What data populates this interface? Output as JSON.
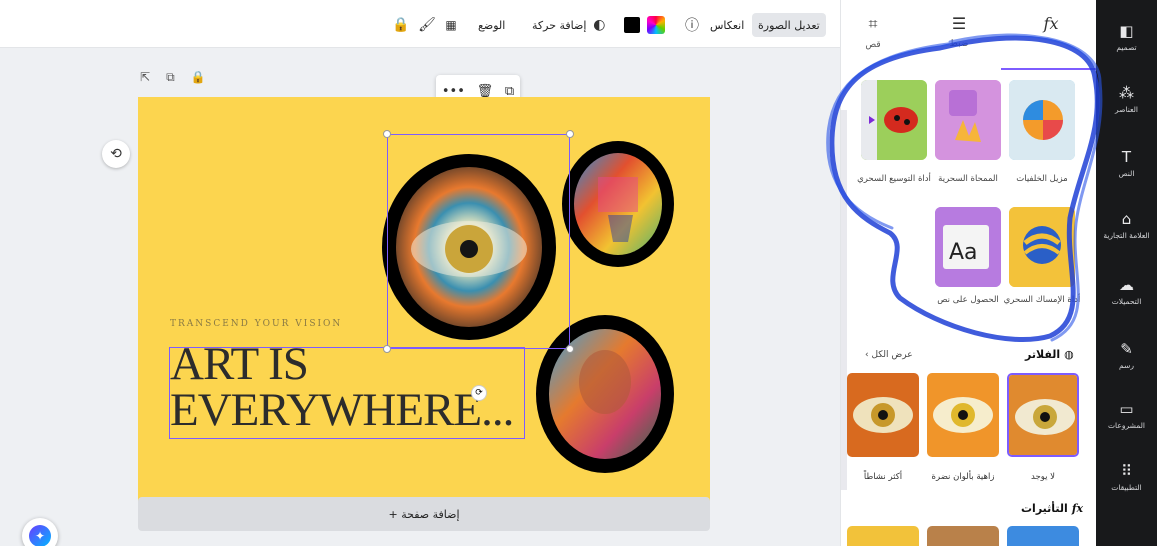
{
  "toolbar": {
    "edit_image": "تعديل الصورة",
    "flip": "انعكاس",
    "add_animation": "إضافة حركة",
    "position": "الوضع"
  },
  "canvas": {
    "tagline": "TRANSCEND YOUR VISION",
    "headline_line1": "ART IS",
    "headline_line2": "EVERYWHERE...",
    "add_page": "+ إضافة صفحة"
  },
  "panel": {
    "tabs": [
      {
        "label": "قص",
        "icon": "crop-icon"
      },
      {
        "label": "ضبط",
        "icon": "sliders-icon"
      },
      {
        "label": "",
        "icon": "fx-icon"
      }
    ],
    "tools": [
      {
        "label": "مزيل الخلفيات"
      },
      {
        "label": "الممحاة السحرية"
      },
      {
        "label": "أداة التوسيع السحري"
      },
      {
        "label": "أداة الإمساك السحري"
      },
      {
        "label": "الحصول على نص"
      }
    ],
    "filters_title": "الفلاتر",
    "see_all": "عرض الكل",
    "filters": [
      {
        "label": "لا يوجد"
      },
      {
        "label": "زاهية بألوان نضرة"
      },
      {
        "label": "أكثر نشاطاً"
      }
    ],
    "effects_title": "التأثيرات"
  },
  "rail": [
    {
      "label": "تصميم",
      "icon": "layout-icon"
    },
    {
      "label": "العناصر",
      "icon": "elements-icon"
    },
    {
      "label": "النص",
      "icon": "text-icon"
    },
    {
      "label": "العلامة التجارية",
      "icon": "brand-icon"
    },
    {
      "label": "التحميلات",
      "icon": "upload-icon"
    },
    {
      "label": "رسم",
      "icon": "draw-icon"
    },
    {
      "label": "المشروعات",
      "icon": "folder-icon"
    },
    {
      "label": "التطبيقات",
      "icon": "apps-icon"
    }
  ],
  "colors": {
    "accent": "#7d5cff",
    "page_bg": "#fcd54f",
    "rail_bg": "#18191b"
  }
}
